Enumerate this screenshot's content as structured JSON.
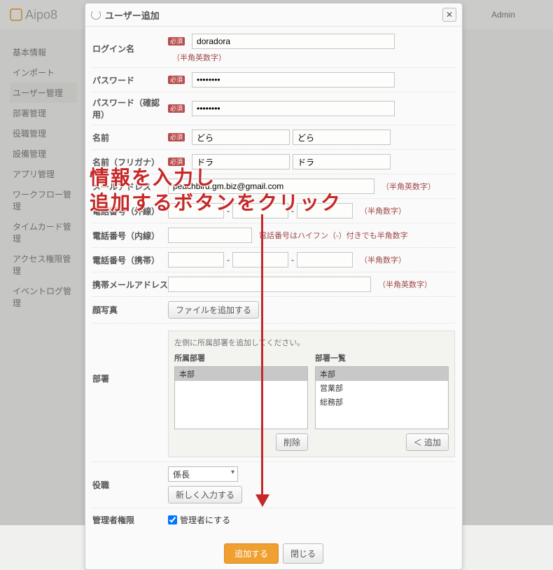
{
  "app": {
    "name": "Aipo8",
    "admin_label": "Admin"
  },
  "sidebar": {
    "items": [
      {
        "label": "基本情報"
      },
      {
        "label": "インポート"
      },
      {
        "label": "ユーザー管理",
        "active": true
      },
      {
        "label": "部署管理"
      },
      {
        "label": "役職管理"
      },
      {
        "label": "設備管理"
      },
      {
        "label": "アプリ管理"
      },
      {
        "label": "ワークフロー管理"
      },
      {
        "label": "タイムカード管理"
      },
      {
        "label": "アクセス権限管理"
      },
      {
        "label": "イベントログ管理"
      }
    ]
  },
  "modal": {
    "title": "ユーザー追加",
    "required_label": "必須",
    "fields": {
      "login": {
        "label": "ログイン名",
        "value": "doradora",
        "hint": "（半角英数字）"
      },
      "password": {
        "label": "パスワード",
        "value": "••••••••"
      },
      "password_confirm": {
        "label": "パスワード（確認用）",
        "value": "••••••••"
      },
      "name": {
        "label": "名前",
        "last": "どら",
        "first": "どら"
      },
      "name_kana": {
        "label": "名前（フリガナ）",
        "last": "ドラ",
        "first": "ドラ"
      },
      "email": {
        "label": "メールアドレス",
        "value": "peachbird.gm.biz@gmail.com",
        "hint": "（半角英数字）"
      },
      "phone_out": {
        "label": "電話番号（外線）",
        "hint": "（半角数字）"
      },
      "phone_in": {
        "label": "電話番号（内線）",
        "hint_text": "電話番号はハイフン（-）付きでも半角数字"
      },
      "phone_mobile": {
        "label": "電話番号（携帯）",
        "hint": "（半角数字）"
      },
      "mobile_email": {
        "label": "携帯メールアドレス",
        "hint": "（半角英数字）"
      },
      "photo": {
        "label": "顔写真",
        "button": "ファイルを追加する"
      },
      "department": {
        "label": "部署",
        "note": "左側に所属部署を追加してください。",
        "assigned_title": "所属部署",
        "list_title": "部署一覧",
        "assigned": [
          "本部"
        ],
        "available": [
          "本部",
          "営業部",
          "総務部"
        ],
        "remove_btn": "削除",
        "add_btn": "＜ 追加"
      },
      "position": {
        "label": "役職",
        "selected": "係長",
        "new_btn": "新しく入力する"
      },
      "admin": {
        "label": "管理者権限",
        "checkbox_label": "管理者にする",
        "checked": true
      }
    },
    "footer": {
      "submit": "追加する",
      "close": "閉じる"
    }
  },
  "annotation": {
    "line1": "情報を入力し",
    "line2": "追加するボタンをクリック"
  }
}
